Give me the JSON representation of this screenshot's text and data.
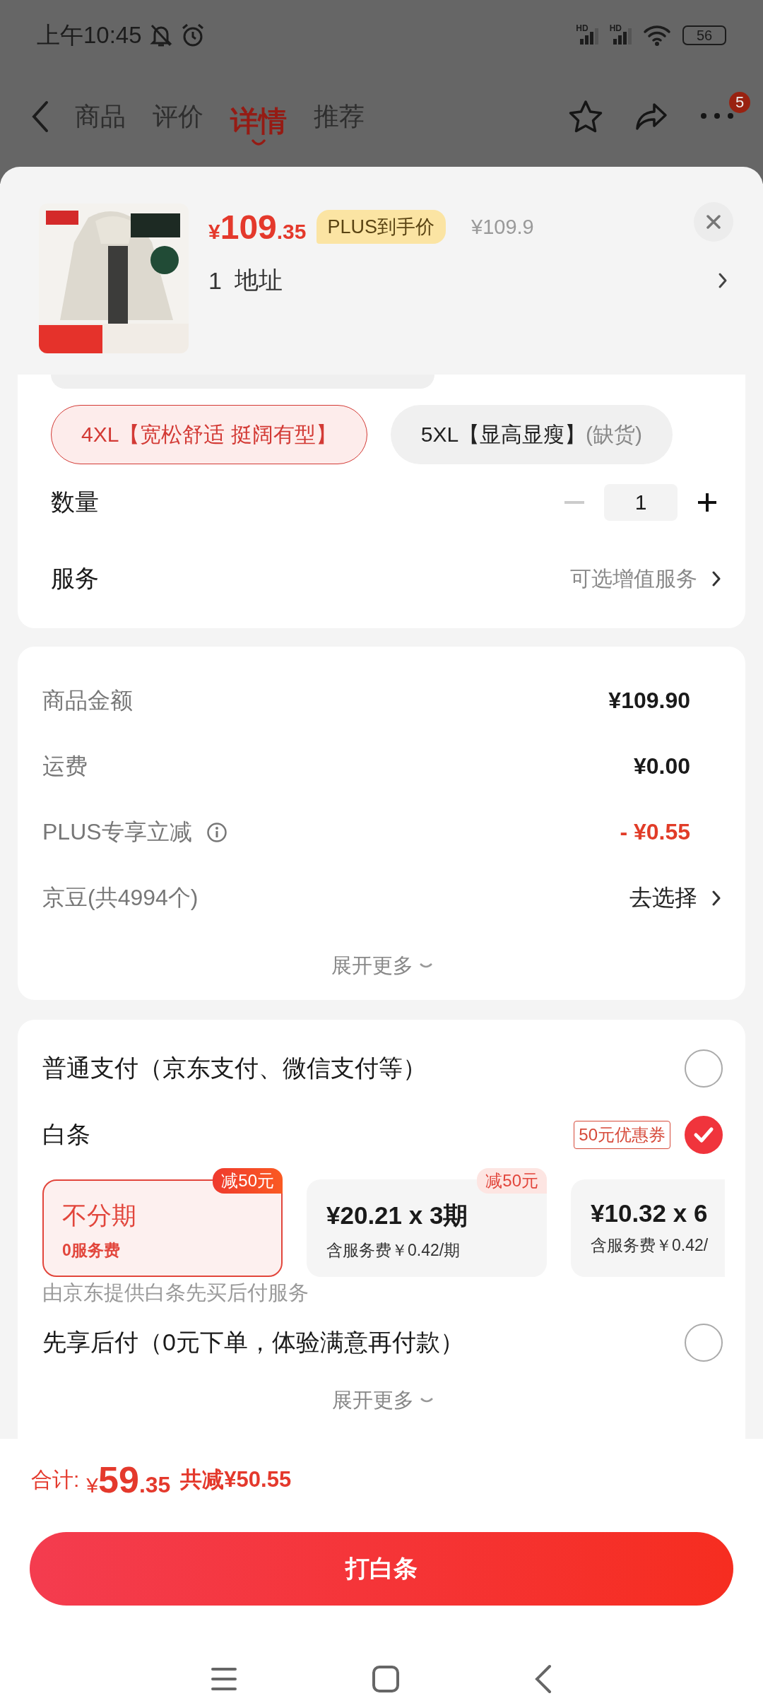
{
  "status_bar": {
    "time": "上午10:45",
    "network_labels": [
      "HD",
      "HD"
    ],
    "battery": "56"
  },
  "nav": {
    "tabs": [
      {
        "label": "商品",
        "selected": false
      },
      {
        "label": "评价",
        "selected": false
      },
      {
        "label": "详情",
        "selected": true
      },
      {
        "label": "推荐",
        "selected": false
      }
    ],
    "badge": "5"
  },
  "product": {
    "currency": "¥",
    "price_int": "109",
    "price_dec": ".35",
    "plus_tag": "PLUS到手价",
    "original_price": "¥109.9",
    "address_count": "1",
    "address": "地址"
  },
  "sku_options": [
    {
      "label": "4XL【宽松舒适 挺阔有型】",
      "selected": true
    },
    {
      "label": "5XL【显高显瘦】",
      "note": "(缺货)",
      "selected": false
    }
  ],
  "quantity": {
    "label": "数量",
    "value": "1",
    "minus_disabled": true
  },
  "service": {
    "label": "服务",
    "value": "可选增值服务"
  },
  "summary": {
    "rows": [
      {
        "kind": "amount",
        "label": "商品金额",
        "value": "¥109.90"
      },
      {
        "kind": "amount",
        "label": "运费",
        "value": "¥0.00"
      },
      {
        "kind": "discount",
        "label": "PLUS专享立减",
        "value": "- ¥0.55",
        "info": true
      },
      {
        "kind": "link",
        "label": "京豆(共4994个)",
        "value": "去选择"
      }
    ],
    "expand": "展开更多"
  },
  "payment": {
    "methods": [
      {
        "kind": "radio",
        "label": "普通支付（京东支付、微信支付等）",
        "checked": false
      },
      {
        "kind": "baitiao",
        "label": "白条",
        "coupon": "50元优惠券",
        "checked": true,
        "plans": [
          {
            "title": "不分期",
            "fee": "0服务费",
            "tag": "减50元",
            "selected": true
          },
          {
            "title": "¥20.21 x 3期",
            "fee": "含服务费￥0.42/期",
            "tag": "减50元",
            "selected": false
          },
          {
            "title": "¥10.32 x 6",
            "fee": "含服务费￥0.42/",
            "selected": false
          }
        ],
        "note": "由京东提供白条先买后付服务"
      },
      {
        "kind": "radio",
        "label": "先享后付（0元下单，体验满意再付款）",
        "checked": false
      }
    ],
    "expand": "展开更多"
  },
  "footer": {
    "total_label": "合计:",
    "currency": "¥",
    "total_int": "59",
    "total_dec": ".35",
    "saved": "共减¥50.55",
    "button": "打白条"
  }
}
